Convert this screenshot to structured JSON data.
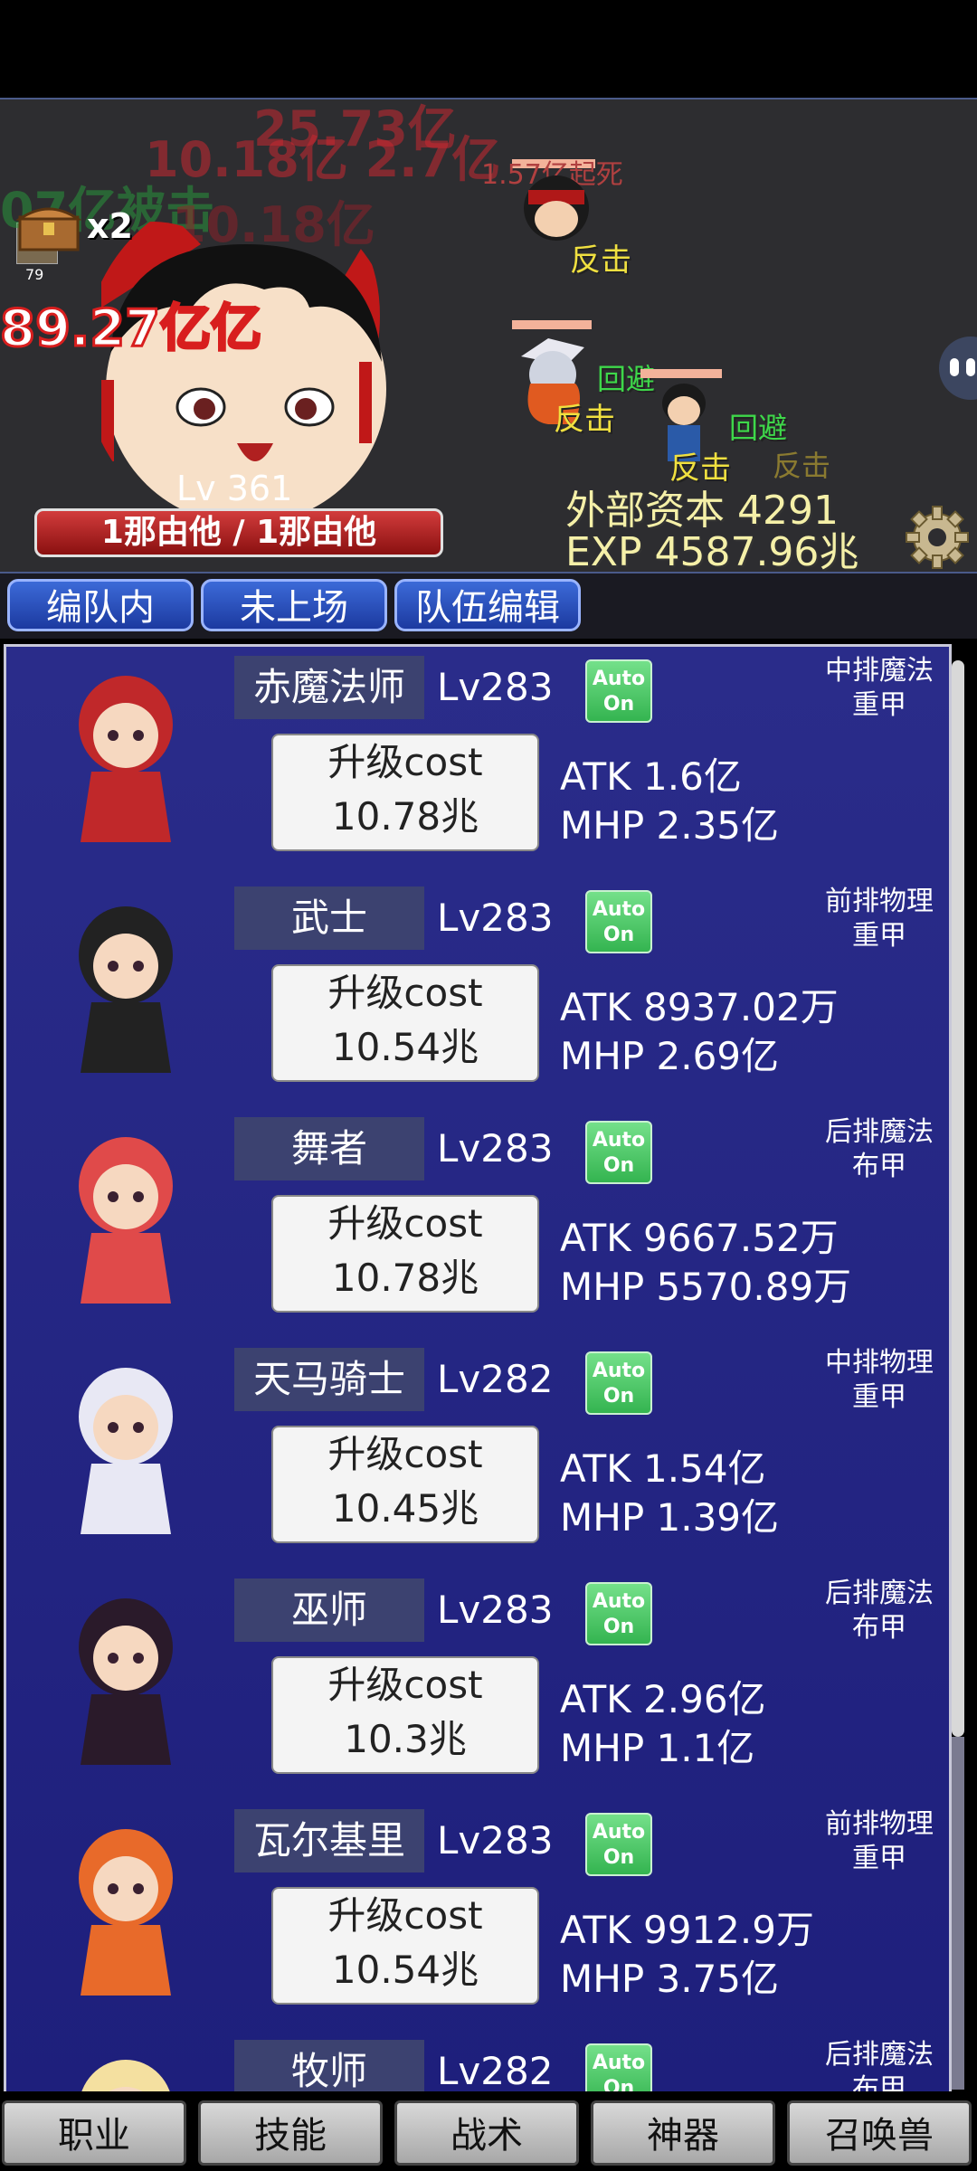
{
  "battle": {
    "avatar_level": "79",
    "chest_count": "x2",
    "damage_numbers": [
      "25.73亿",
      "10.18亿 2.7亿",
      "07亿被击",
      "10.18亿",
      "89.27亿亿"
    ],
    "battle_texts": {
      "death": "1.57亿起死",
      "counter1": "反击",
      "dodge1": "回避",
      "counter2": "反击",
      "dodge2": "回避",
      "counter3": "反击",
      "counter4": "反击"
    },
    "boss_level": "Lv 361",
    "boss_hp": "1那由他 / 1那由他",
    "external_capital": "外部资本 4291",
    "exp": "EXP 4587.96兆"
  },
  "tabs": [
    "编队内",
    "未上场",
    "队伍编辑"
  ],
  "units": [
    {
      "name": "赤魔法师",
      "level": "Lv283",
      "auto1": "Auto",
      "auto2": "On",
      "role1": "中排魔法",
      "role2": "重甲",
      "cost_label": "升级cost",
      "cost": "10.78兆",
      "atk": "ATK 1.6亿",
      "mhp": "MHP 2.35亿",
      "color": "#c0282a"
    },
    {
      "name": "武士",
      "level": "Lv283",
      "auto1": "Auto",
      "auto2": "On",
      "role1": "前排物理",
      "role2": "重甲",
      "cost_label": "升级cost",
      "cost": "10.54兆",
      "atk": "ATK 8937.02万",
      "mhp": "MHP 2.69亿",
      "color": "#222222"
    },
    {
      "name": "舞者",
      "level": "Lv283",
      "auto1": "Auto",
      "auto2": "On",
      "role1": "后排魔法",
      "role2": "布甲",
      "cost_label": "升级cost",
      "cost": "10.78兆",
      "atk": "ATK 9667.52万",
      "mhp": "MHP 5570.89万",
      "color": "#e04a4a"
    },
    {
      "name": "天马骑士",
      "level": "Lv282",
      "auto1": "Auto",
      "auto2": "On",
      "role1": "中排物理",
      "role2": "重甲",
      "cost_label": "升级cost",
      "cost": "10.45兆",
      "atk": "ATK 1.54亿",
      "mhp": "MHP 1.39亿",
      "color": "#e8e8f4"
    },
    {
      "name": "巫师",
      "level": "Lv283",
      "auto1": "Auto",
      "auto2": "On",
      "role1": "后排魔法",
      "role2": "布甲",
      "cost_label": "升级cost",
      "cost": "10.3兆",
      "atk": "ATK 2.96亿",
      "mhp": "MHP 1.1亿",
      "color": "#2a1a2a"
    },
    {
      "name": "瓦尔基里",
      "level": "Lv283",
      "auto1": "Auto",
      "auto2": "On",
      "role1": "前排物理",
      "role2": "重甲",
      "cost_label": "升级cost",
      "cost": "10.54兆",
      "atk": "ATK 9912.9万",
      "mhp": "MHP 3.75亿",
      "color": "#e86a2a"
    },
    {
      "name": "牧师",
      "level": "Lv282",
      "auto1": "Auto",
      "auto2": "On",
      "role1": "后排魔法",
      "role2": "布甲",
      "cost_label": "",
      "cost": "",
      "atk": "",
      "mhp": "",
      "color": "#f4e0a0"
    }
  ],
  "bottom_tabs": [
    "职业",
    "技能",
    "战术",
    "神器",
    "召唤兽"
  ]
}
